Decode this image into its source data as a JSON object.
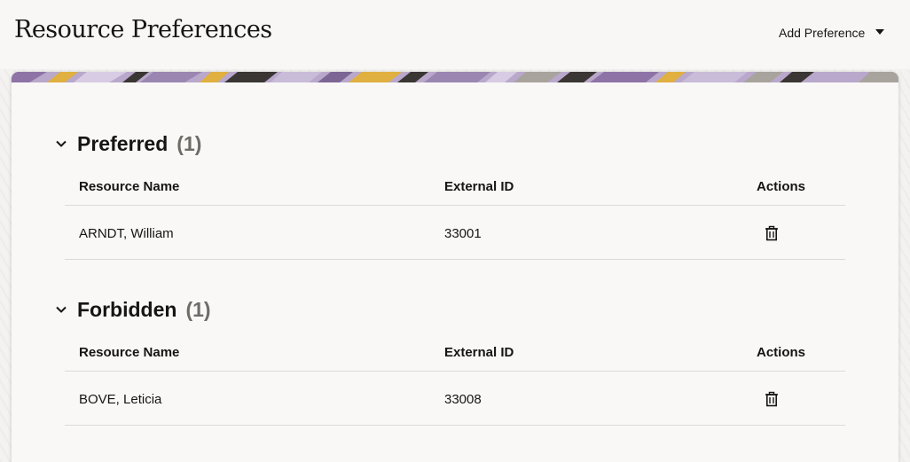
{
  "page": {
    "title": "Resource Preferences",
    "add_preference_label": "Add Preference"
  },
  "sections": [
    {
      "title": "Preferred",
      "count": "(1)",
      "columns": {
        "name": "Resource Name",
        "external_id": "External ID",
        "actions": "Actions"
      },
      "rows": [
        {
          "name": "ARNDT, William",
          "external_id": "33001"
        }
      ]
    },
    {
      "title": "Forbidden",
      "count": "(1)",
      "columns": {
        "name": "Resource Name",
        "external_id": "External ID",
        "actions": "Actions"
      },
      "rows": [
        {
          "name": "BOVE, Leticia",
          "external_id": "33008"
        }
      ]
    }
  ],
  "icons": {
    "section_toggle": "chevron-down-icon",
    "delete_action": "trash-icon",
    "menu_caret": "caret-down-icon"
  },
  "colors": {
    "text": "#161513",
    "count_text": "#6f6c68",
    "banner_purple": "#8d73a6",
    "banner_gold": "#e0b040",
    "banner_dark": "#3a3633",
    "divider": "#dcdad7"
  }
}
